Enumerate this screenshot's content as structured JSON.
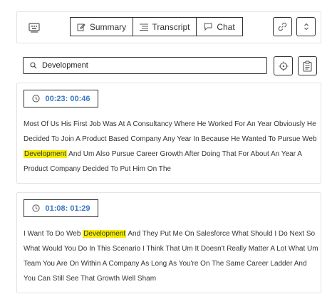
{
  "toolbar": {
    "tabs": [
      {
        "label": "Summary",
        "icon": "edit-icon"
      },
      {
        "label": "Transcript",
        "icon": "transcript-list-icon"
      },
      {
        "label": "Chat",
        "icon": "chat-icon"
      }
    ],
    "left_icon": "keyboard-window-icon",
    "link_icon": "link-icon",
    "expand_icon": "chevron-up-down-icon"
  },
  "search": {
    "value": "Development",
    "icon": "search-icon"
  },
  "utility_icons": [
    "target-icon",
    "clipboard-icon"
  ],
  "highlight_color": "#f6ee00",
  "timestamp_color": "#3b78c2",
  "results": [
    {
      "timestamp": "00:23: 00:46",
      "before": "Most Of Us His First Job Was At A Consultancy Where He Worked For An Year Obviously He Decided To Join A Product Based Company Any Year In Because He Wanted To Pursue Web ",
      "match": "Development",
      "after": " And Um Also Pursue Career Growth After Doing That For About An Year A Product Company Decided To Put Him On The"
    },
    {
      "timestamp": "01:08: 01:29",
      "before": "I Want To Do Web ",
      "match": "Development",
      "after": " And They Put Me On Salesforce What Should I Do Next So What Would You Do In This Scenario I Think That Um It Doesn't Really Matter A Lot What Um Team You Are On Within A Company As Long As You're On The Same Career Ladder And You Can Still See That Growth Well Sham"
    }
  ]
}
